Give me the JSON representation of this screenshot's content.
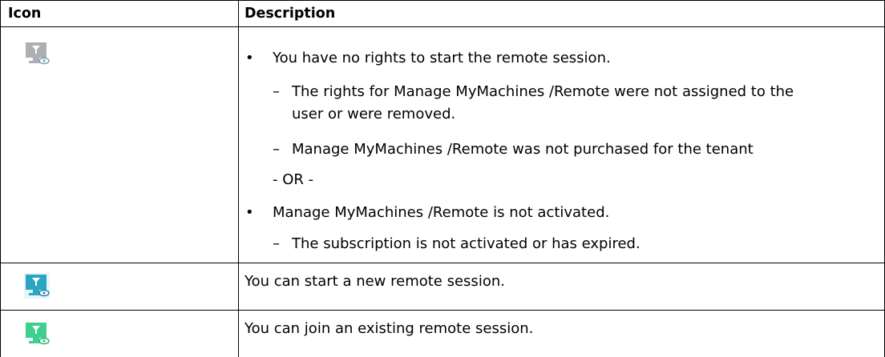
{
  "table": {
    "headers": {
      "icon": "Icon",
      "description": "Description"
    },
    "rows": [
      {
        "icon": {
          "name": "remote-session-unavailable-icon",
          "color": "#aab0b3",
          "accent": "#7ea0b4"
        },
        "items": [
          "You have no rights to start the remote session.",
          "The rights for Manage MyMachines /Remote were not assigned to the",
          "user or were removed.",
          "Manage MyMachines /Remote was not purchased for the tenant",
          "- OR -",
          "Manage MyMachines /Remote is not activated.",
          "The subscription is not activated or has expired."
        ]
      },
      {
        "icon": {
          "name": "remote-session-start-icon",
          "color": "#2aa6c4",
          "accent": "#1b87a8"
        },
        "text": "You can start a new remote session."
      },
      {
        "icon": {
          "name": "remote-session-join-icon",
          "color": "#3fcf8f",
          "accent": "#28b474"
        },
        "text": "You can join an existing remote session."
      }
    ],
    "bullet_symbol": "•",
    "dash_symbol": "–"
  }
}
